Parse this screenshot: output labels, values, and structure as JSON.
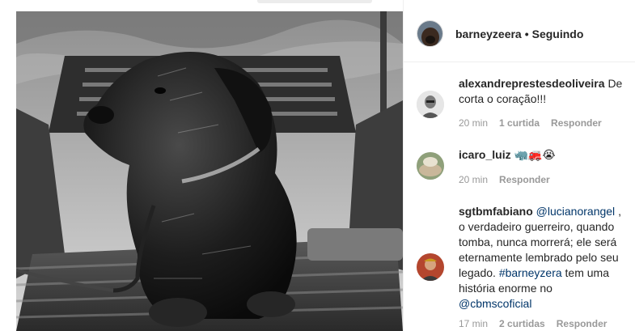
{
  "post": {
    "author": "barneyzeera",
    "separator": "•",
    "follow_status": "Seguindo"
  },
  "comments": [
    {
      "user": "alexandreprestesdeoliveira",
      "text": "De corta o coração!!!",
      "time": "20 min",
      "likes": "1 curtida",
      "reply": "Responder"
    },
    {
      "user": "icaro_luiz",
      "text": "🦏🚒😭",
      "time": "20 min",
      "reply": "Responder"
    },
    {
      "user": "sgtbmfabiano",
      "mention": "@lucianorangel",
      "text_a": ", o verdadeiro guerreiro, quando tomba, nunca morrerá; ele será eternamente lembrado pelo seu legado.",
      "hashtag": "#barneyzera",
      "text_b": "tem uma história enorme no",
      "mention2": "@cbmscoficial",
      "time": "17 min",
      "likes": "2 curtidas",
      "reply": "Responder"
    }
  ]
}
